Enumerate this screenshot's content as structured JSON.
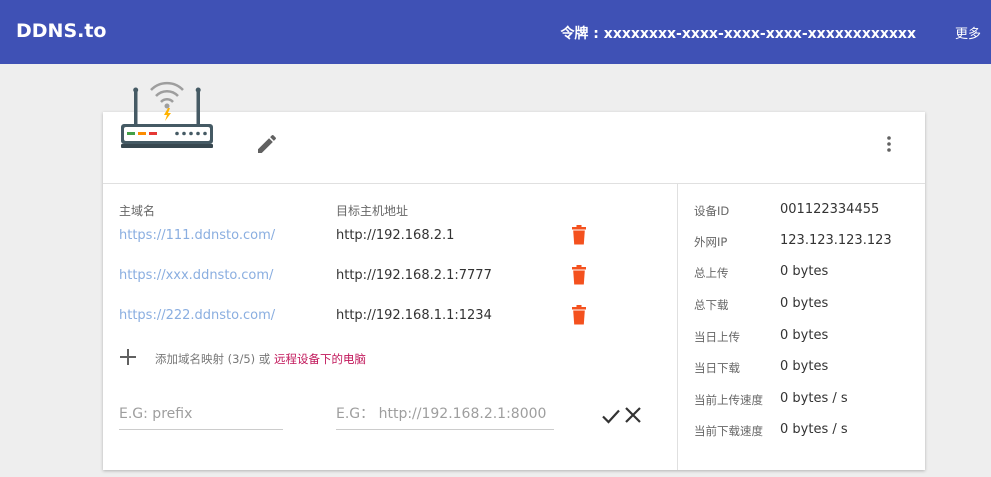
{
  "header": {
    "brand": "DDNS.to",
    "token": "令牌 : xxxxxxxx-xxxx-xxxx-xxxx-xxxxxxxxxxxx",
    "more_label": "更多"
  },
  "icons": {
    "router": "router-icon",
    "edit": "pencil-icon",
    "menu": "vertical-dots-icon",
    "delete": "trash-icon",
    "add": "plus-icon",
    "confirm": "check-icon",
    "cancel": "close-icon"
  },
  "colors": {
    "header_bg": "#3f51b5",
    "link": "#8aaee0",
    "delete": "#f4511e",
    "accent_link": "#c2185b"
  },
  "mappings": {
    "domain_header": "主域名",
    "target_header": "目标主机地址",
    "rows": [
      {
        "domain": "https://111.ddnsto.com/",
        "target": "http://192.168.2.1"
      },
      {
        "domain": "https://xxx.ddnsto.com/",
        "target": "http://192.168.2.1:7777"
      },
      {
        "domain": "https://222.ddnsto.com/",
        "target": "http://192.168.1.1:1234"
      }
    ],
    "add_text": "添加域名映射 (3/5) 或 ",
    "add_link": "远程设备下的电脑",
    "prefix_placeholder": "E.G: prefix",
    "target_placeholder": "E.G： http://192.168.2.1:8000"
  },
  "device": {
    "stats": [
      {
        "label": "设备ID",
        "value": "001122334455"
      },
      {
        "label": "外网IP",
        "value": "123.123.123.123"
      },
      {
        "label": "总上传",
        "value": "0 bytes"
      },
      {
        "label": "总下载",
        "value": "0 bytes"
      },
      {
        "label": "当日上传",
        "value": "0 bytes"
      },
      {
        "label": "当日下载",
        "value": "0 bytes"
      },
      {
        "label": "当前上传速度",
        "value": "0 bytes / s"
      },
      {
        "label": "当前下载速度",
        "value": "0 bytes / s"
      }
    ]
  }
}
